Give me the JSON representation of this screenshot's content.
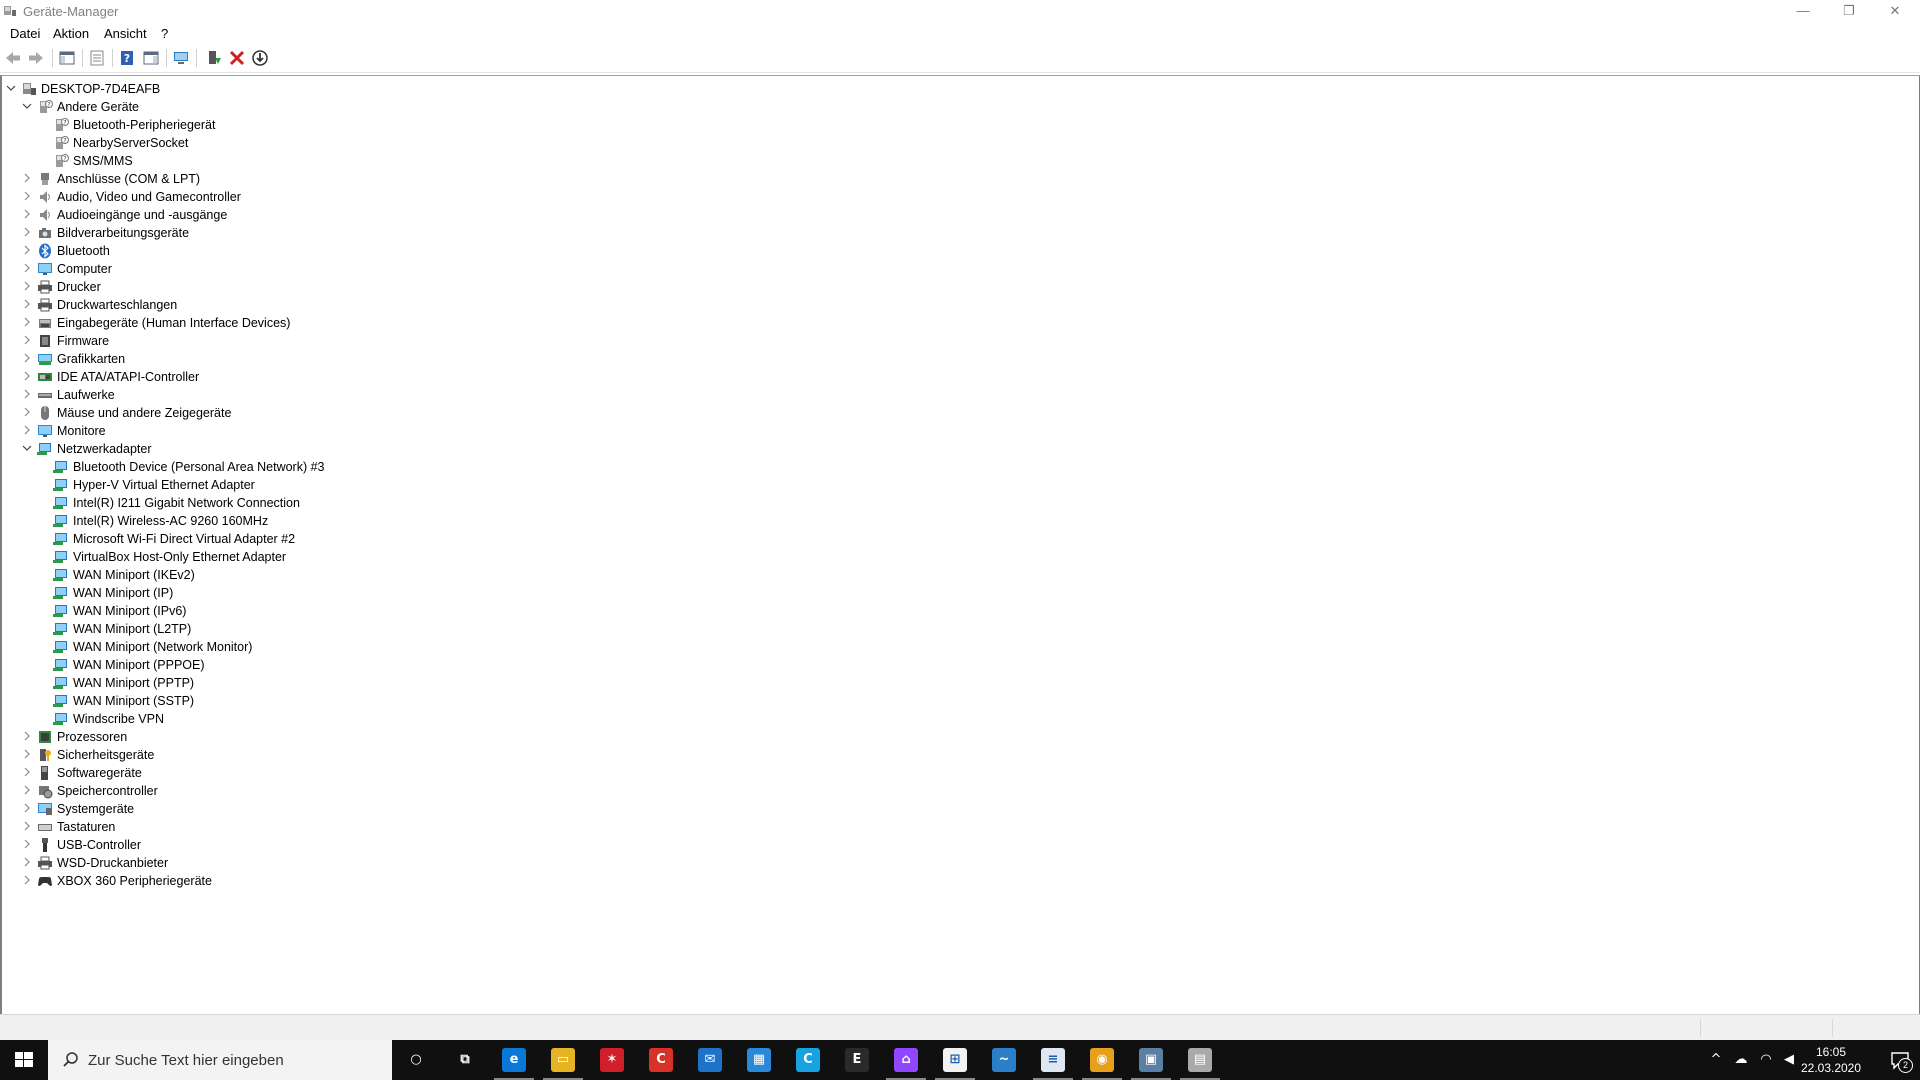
{
  "window": {
    "title": "Geräte-Manager",
    "controls": {
      "minimize": "—",
      "restore": "❐",
      "close": "✕"
    }
  },
  "menu": [
    "Datei",
    "Aktion",
    "Ansicht",
    "?"
  ],
  "toolbar": {
    "buttons": [
      "back-icon",
      "forward-icon",
      "show-hide-console-tree-icon",
      "properties-icon",
      "help-icon",
      "show-hide-action-pane-icon",
      "scan-hardware-icon",
      "update-driver-icon",
      "uninstall-device-icon",
      "disable-device-icon"
    ]
  },
  "tree": {
    "root": "DESKTOP-7D4EAFB",
    "rows": [
      {
        "label": "DESKTOP-7D4EAFB",
        "level": 0,
        "expander": "expanded",
        "icon": "computer-icon"
      },
      {
        "label": "Andere Geräte",
        "level": 1,
        "expander": "expanded",
        "icon": "unknown-device-icon"
      },
      {
        "label": "Bluetooth-Peripheriegerät",
        "level": 2,
        "expander": "none",
        "icon": "unknown-device-icon"
      },
      {
        "label": "NearbyServerSocket",
        "level": 2,
        "expander": "none",
        "icon": "unknown-device-icon"
      },
      {
        "label": "SMS/MMS",
        "level": 2,
        "expander": "none",
        "icon": "unknown-device-icon"
      },
      {
        "label": "Anschlüsse (COM & LPT)",
        "level": 1,
        "expander": "collapsed",
        "icon": "port-icon"
      },
      {
        "label": "Audio, Video und Gamecontroller",
        "level": 1,
        "expander": "collapsed",
        "icon": "speaker-icon"
      },
      {
        "label": "Audioeingänge und -ausgänge",
        "level": 1,
        "expander": "collapsed",
        "icon": "speaker-icon"
      },
      {
        "label": "Bildverarbeitungsgeräte",
        "level": 1,
        "expander": "collapsed",
        "icon": "camera-icon"
      },
      {
        "label": "Bluetooth",
        "level": 1,
        "expander": "collapsed",
        "icon": "bluetooth-icon"
      },
      {
        "label": "Computer",
        "level": 1,
        "expander": "collapsed",
        "icon": "monitor-icon"
      },
      {
        "label": "Drucker",
        "level": 1,
        "expander": "collapsed",
        "icon": "printer-icon"
      },
      {
        "label": "Druckwarteschlangen",
        "level": 1,
        "expander": "collapsed",
        "icon": "printer-icon"
      },
      {
        "label": "Eingabegeräte (Human Interface Devices)",
        "level": 1,
        "expander": "collapsed",
        "icon": "hid-icon"
      },
      {
        "label": "Firmware",
        "level": 1,
        "expander": "collapsed",
        "icon": "firmware-icon"
      },
      {
        "label": "Grafikkarten",
        "level": 1,
        "expander": "collapsed",
        "icon": "display-adapter-icon"
      },
      {
        "label": "IDE ATA/ATAPI-Controller",
        "level": 1,
        "expander": "collapsed",
        "icon": "controller-icon"
      },
      {
        "label": "Laufwerke",
        "level": 1,
        "expander": "collapsed",
        "icon": "drive-icon"
      },
      {
        "label": "Mäuse und andere Zeigegeräte",
        "level": 1,
        "expander": "collapsed",
        "icon": "mouse-icon"
      },
      {
        "label": "Monitore",
        "level": 1,
        "expander": "collapsed",
        "icon": "monitor-icon"
      },
      {
        "label": "Netzwerkadapter",
        "level": 1,
        "expander": "expanded",
        "icon": "network-adapter-icon"
      },
      {
        "label": "Bluetooth Device (Personal Area Network) #3",
        "level": 2,
        "expander": "none",
        "icon": "network-adapter-icon"
      },
      {
        "label": "Hyper-V Virtual Ethernet Adapter",
        "level": 2,
        "expander": "none",
        "icon": "network-adapter-icon"
      },
      {
        "label": "Intel(R) I211 Gigabit Network Connection",
        "level": 2,
        "expander": "none",
        "icon": "network-adapter-icon"
      },
      {
        "label": "Intel(R) Wireless-AC 9260 160MHz",
        "level": 2,
        "expander": "none",
        "icon": "network-adapter-icon"
      },
      {
        "label": "Microsoft Wi-Fi Direct Virtual Adapter #2",
        "level": 2,
        "expander": "none",
        "icon": "network-adapter-icon"
      },
      {
        "label": "VirtualBox Host-Only Ethernet Adapter",
        "level": 2,
        "expander": "none",
        "icon": "network-adapter-icon"
      },
      {
        "label": "WAN Miniport (IKEv2)",
        "level": 2,
        "expander": "none",
        "icon": "network-adapter-icon"
      },
      {
        "label": "WAN Miniport (IP)",
        "level": 2,
        "expander": "none",
        "icon": "network-adapter-icon"
      },
      {
        "label": "WAN Miniport (IPv6)",
        "level": 2,
        "expander": "none",
        "icon": "network-adapter-icon"
      },
      {
        "label": "WAN Miniport (L2TP)",
        "level": 2,
        "expander": "none",
        "icon": "network-adapter-icon"
      },
      {
        "label": "WAN Miniport (Network Monitor)",
        "level": 2,
        "expander": "none",
        "icon": "network-adapter-icon"
      },
      {
        "label": "WAN Miniport (PPPOE)",
        "level": 2,
        "expander": "none",
        "icon": "network-adapter-icon"
      },
      {
        "label": "WAN Miniport (PPTP)",
        "level": 2,
        "expander": "none",
        "icon": "network-adapter-icon"
      },
      {
        "label": "WAN Miniport (SSTP)",
        "level": 2,
        "expander": "none",
        "icon": "network-adapter-icon"
      },
      {
        "label": "Windscribe VPN",
        "level": 2,
        "expander": "none",
        "icon": "network-adapter-icon"
      },
      {
        "label": "Prozessoren",
        "level": 1,
        "expander": "collapsed",
        "icon": "processor-icon"
      },
      {
        "label": "Sicherheitsgeräte",
        "level": 1,
        "expander": "collapsed",
        "icon": "security-key-icon"
      },
      {
        "label": "Softwaregeräte",
        "level": 1,
        "expander": "collapsed",
        "icon": "software-device-icon"
      },
      {
        "label": "Speichercontroller",
        "level": 1,
        "expander": "collapsed",
        "icon": "storage-controller-icon"
      },
      {
        "label": "Systemgeräte",
        "level": 1,
        "expander": "collapsed",
        "icon": "system-device-icon"
      },
      {
        "label": "Tastaturen",
        "level": 1,
        "expander": "collapsed",
        "icon": "keyboard-icon"
      },
      {
        "label": "USB-Controller",
        "level": 1,
        "expander": "collapsed",
        "icon": "usb-icon"
      },
      {
        "label": "WSD-Druckanbieter",
        "level": 1,
        "expander": "collapsed",
        "icon": "printer-icon"
      },
      {
        "label": "XBOX 360 Peripheriegeräte",
        "level": 1,
        "expander": "collapsed",
        "icon": "gamepad-icon"
      }
    ]
  },
  "taskbar": {
    "search_placeholder": "Zur Suche Text hier eingeben",
    "apps": [
      {
        "name": "cortana-icon",
        "glyph": "○",
        "color": "#101010",
        "active": false
      },
      {
        "name": "task-view-icon",
        "glyph": "⧉",
        "color": "#101010",
        "active": false
      },
      {
        "name": "edge-icon",
        "glyph": "e",
        "color": "#0a78d7",
        "active": true
      },
      {
        "name": "file-explorer-icon",
        "glyph": "▭",
        "color": "#e6b422",
        "active": true
      },
      {
        "name": "red-app-icon",
        "glyph": "✶",
        "color": "#d01f2b",
        "active": false
      },
      {
        "name": "ccleaner-icon",
        "glyph": "C",
        "color": "#d8312a",
        "active": false
      },
      {
        "name": "mail-icon",
        "glyph": "✉",
        "color": "#1e73c8",
        "active": false
      },
      {
        "name": "office-icon",
        "glyph": "▦",
        "color": "#2b88d8",
        "active": false
      },
      {
        "name": "c-app-icon",
        "glyph": "C",
        "color": "#16a3e0",
        "active": false
      },
      {
        "name": "epic-games-icon",
        "glyph": "E",
        "color": "#2a2a2a",
        "active": false
      },
      {
        "name": "twitch-icon",
        "glyph": "⌂",
        "color": "#9146ff",
        "active": true
      },
      {
        "name": "store-icon",
        "glyph": "⊞",
        "color": "#f2f2f2",
        "active": true
      },
      {
        "name": "dolphin-icon",
        "glyph": "~",
        "color": "#2a7fc8",
        "active": false
      },
      {
        "name": "notepad-icon",
        "glyph": "≡",
        "color": "#dfe8f2",
        "active": true
      },
      {
        "name": "chrome-icon",
        "glyph": "◉",
        "color": "#e6a01c",
        "active": true
      },
      {
        "name": "device-manager-icon",
        "glyph": "▣",
        "color": "#5a7fa3",
        "active": true
      },
      {
        "name": "printer-app-icon",
        "glyph": "▤",
        "color": "#a9a9a9",
        "active": true
      }
    ],
    "tray": [
      "show-hidden-icons-icon",
      "onedrive-icon",
      "wifi-icon",
      "volume-icon"
    ],
    "time": "16:05",
    "date": "22.03.2020",
    "notification_count": "2"
  }
}
